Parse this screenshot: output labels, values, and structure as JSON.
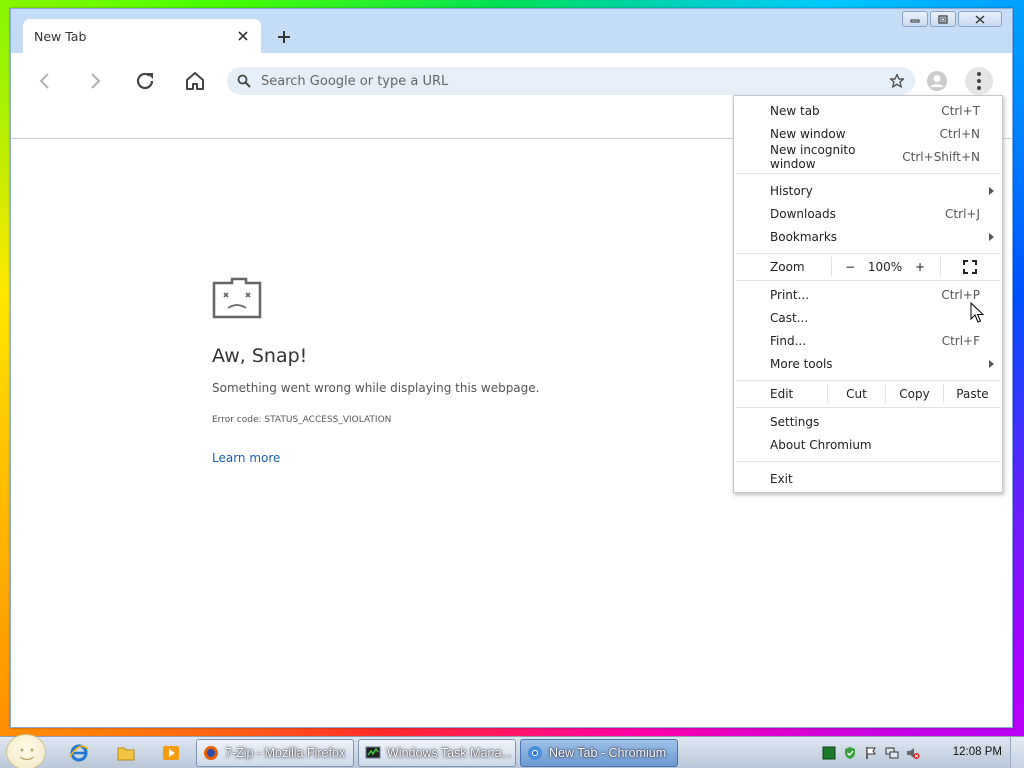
{
  "browser": {
    "tab_title": "New Tab",
    "omnibox_placeholder": "Search Google or type a URL"
  },
  "error_page": {
    "heading": "Aw, Snap!",
    "message": "Something went wrong while displaying this webpage.",
    "error_code": "Error code: STATUS_ACCESS_VIOLATION",
    "learn_more": "Learn more"
  },
  "menu": {
    "group1": [
      {
        "label": "New tab",
        "shortcut": "Ctrl+T"
      },
      {
        "label": "New window",
        "shortcut": "Ctrl+N"
      },
      {
        "label": "New incognito window",
        "shortcut": "Ctrl+Shift+N"
      }
    ],
    "group2": [
      {
        "label": "History",
        "shortcut": ""
      },
      {
        "label": "Downloads",
        "shortcut": "Ctrl+J"
      },
      {
        "label": "Bookmarks",
        "shortcut": ""
      }
    ],
    "zoom": {
      "label": "Zoom",
      "minus": "−",
      "value": "100%",
      "plus": "+"
    },
    "group3": [
      {
        "label": "Print...",
        "shortcut": "Ctrl+P"
      },
      {
        "label": "Cast...",
        "shortcut": ""
      },
      {
        "label": "Find...",
        "shortcut": "Ctrl+F"
      },
      {
        "label": "More tools",
        "shortcut": ""
      }
    ],
    "edit": {
      "label": "Edit",
      "cut": "Cut",
      "copy": "Copy",
      "paste": "Paste"
    },
    "group4": [
      {
        "label": "Settings",
        "shortcut": ""
      },
      {
        "label": "About Chromium",
        "shortcut": ""
      }
    ],
    "exit": {
      "label": "Exit"
    }
  },
  "taskbar": {
    "items": [
      {
        "label": "7-Zip - Mozilla Firefox",
        "active": false
      },
      {
        "label": "Windows Task Mana...",
        "active": false
      },
      {
        "label": "New Tab - Chromium",
        "active": true
      }
    ],
    "clock": "12:08 PM"
  },
  "colors": {
    "accent": "#1a5fb4",
    "titlebar": "#c4dcf5",
    "omnibox": "#e6eef7"
  }
}
